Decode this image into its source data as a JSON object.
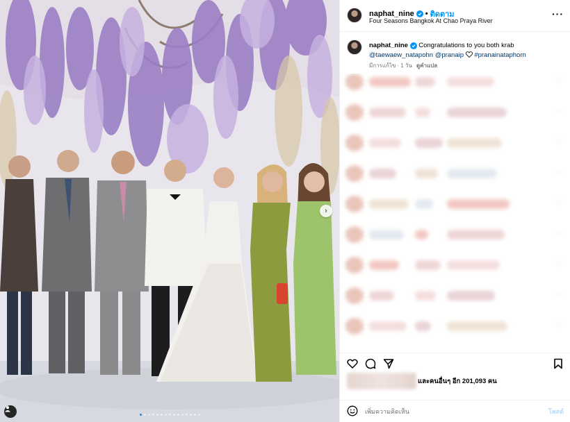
{
  "post": {
    "username": "naphat_nine",
    "follow_label": "ติดตาม",
    "separator": "•",
    "location": "Four Seasons Bangkok At Chao Praya River",
    "more_icon": "more-horizontal-icon"
  },
  "caption": {
    "username": "naphat_nine",
    "text": "Congratulations to you both krab",
    "mention_1": "@taewaew_natapohn",
    "mention_2": "@pranaip",
    "hashtag": "#pranainataphorn",
    "edited_label": "มีการแก้ไข",
    "time_label": "· 1 วัน",
    "translate_label": "ดูคำแปล"
  },
  "carousel": {
    "slide_count": 15,
    "current_slide": 1,
    "active_dot_color": "#1d8af0"
  },
  "comments": {
    "blurred": true,
    "rows": 9
  },
  "actions": {
    "like_icon": "heart-icon",
    "comment_icon": "comment-icon",
    "share_icon": "send-icon",
    "save_icon": "bookmark-icon"
  },
  "likes": {
    "text": "และคนอื่นๆ อีก 201,093 คน"
  },
  "compose": {
    "placeholder": "เพิ่มความคิดเห็น",
    "post_label": "โพสต์",
    "emoji_icon": "smiley-icon"
  },
  "colors": {
    "link_blue": "#0095f6",
    "mention_blue": "#00376b",
    "post_disabled": "#b6dcfb"
  }
}
